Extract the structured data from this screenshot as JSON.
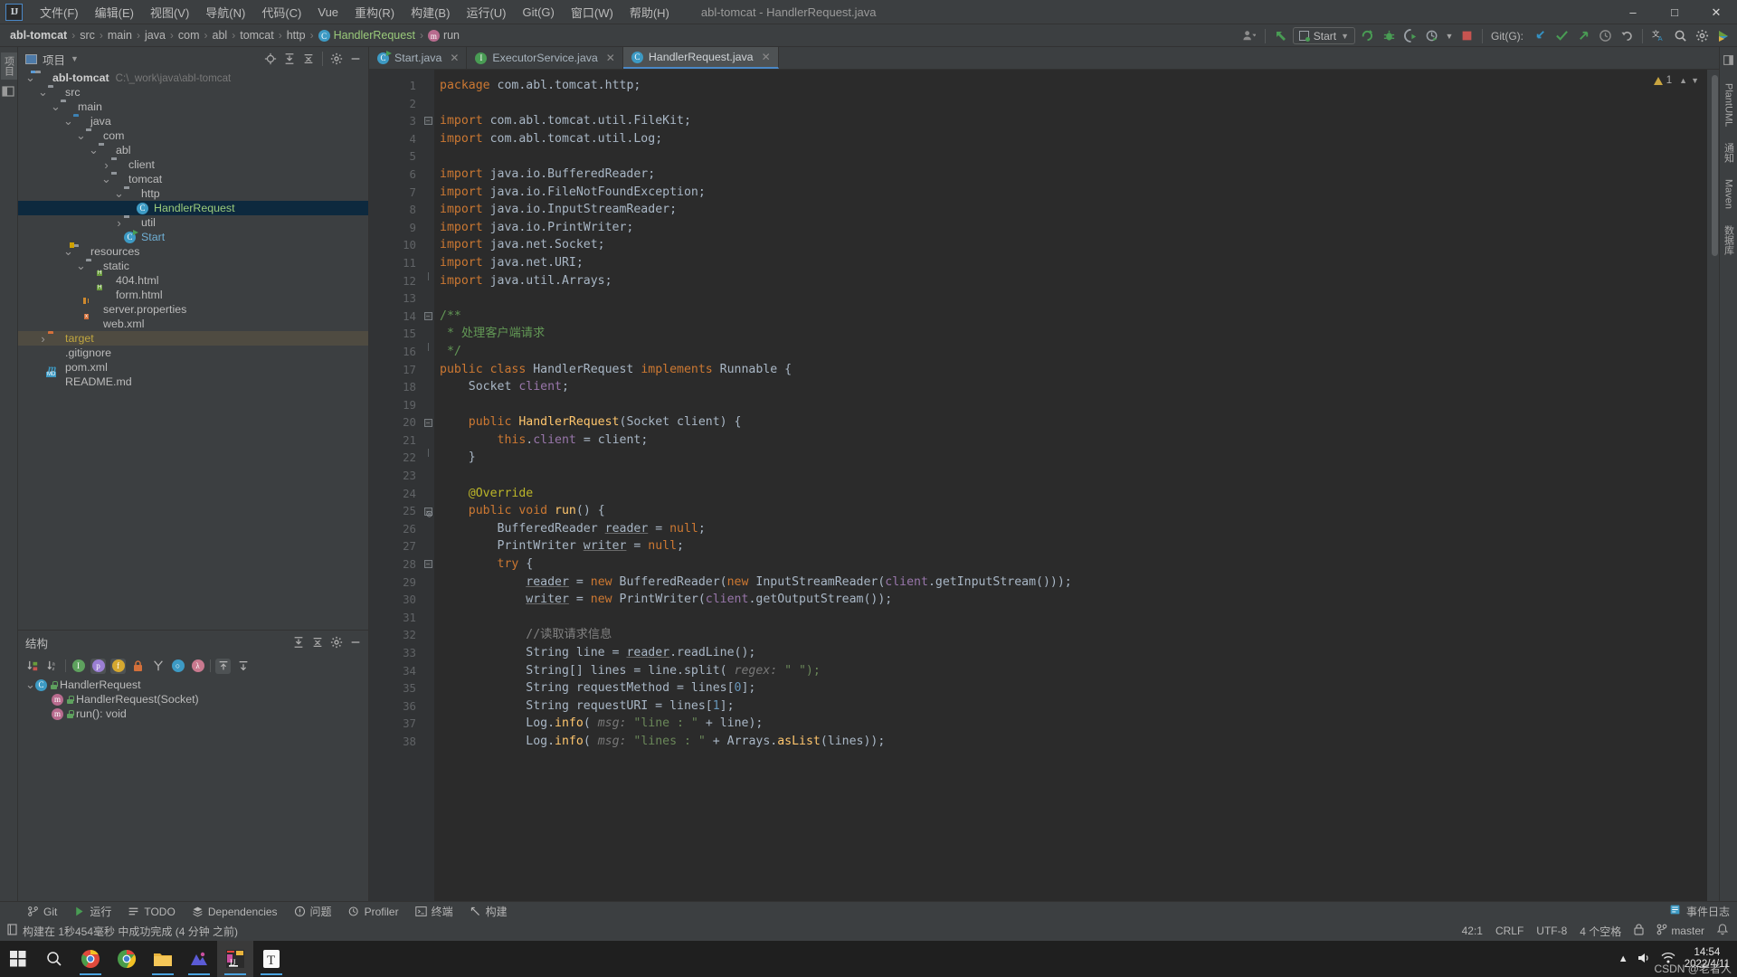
{
  "window": {
    "title": "abl-tomcat - HandlerRequest.java",
    "controls": [
      "minimize",
      "maximize",
      "close"
    ]
  },
  "menubar": {
    "logo": "ij-logo",
    "items": [
      "文件(F)",
      "编辑(E)",
      "视图(V)",
      "导航(N)",
      "代码(C)",
      "Vue",
      "重构(R)",
      "构建(B)",
      "运行(U)",
      "Git(G)",
      "窗口(W)",
      "帮助(H)"
    ]
  },
  "navbar": {
    "breadcrumbs": [
      {
        "label": "abl-tomcat",
        "kind": "project"
      },
      {
        "label": "src",
        "kind": "folder"
      },
      {
        "label": "main",
        "kind": "folder"
      },
      {
        "label": "java",
        "kind": "folder"
      },
      {
        "label": "com",
        "kind": "package"
      },
      {
        "label": "abl",
        "kind": "package"
      },
      {
        "label": "tomcat",
        "kind": "package"
      },
      {
        "label": "http",
        "kind": "package"
      },
      {
        "label": "HandlerRequest",
        "kind": "class"
      },
      {
        "label": "run",
        "kind": "method"
      }
    ],
    "run_config": "Start",
    "git_label": "Git(G):",
    "icons": [
      "user-avatar-icon",
      "back-arrow-icon",
      "run-config-selector",
      "run-icon",
      "debug-icon",
      "run-coverage-icon",
      "profiler-icon",
      "stop-icon",
      "git-update-icon",
      "git-commit-icon",
      "git-push-icon",
      "git-history-icon",
      "git-rollback-icon",
      "translate-icon",
      "search-icon",
      "settings-icon",
      "ide-assistant-icon"
    ]
  },
  "left_rail": {
    "items": [
      "项目",
      "结构"
    ]
  },
  "right_rail": {
    "items": [
      "PlantUML",
      "通知",
      "Maven",
      "数据库",
      "事件日志"
    ]
  },
  "project_panel": {
    "title": "项目",
    "actions": [
      "locate-icon",
      "expand-all-icon",
      "collapse-all-icon",
      "settings-icon",
      "hide-icon"
    ],
    "tree": [
      {
        "depth": 0,
        "label": "abl-tomcat",
        "path": "C:\\_work\\java\\abl-tomcat",
        "icon": "module-folder",
        "arrow": "down",
        "style": "bold"
      },
      {
        "depth": 1,
        "label": "src",
        "icon": "folder",
        "arrow": "down"
      },
      {
        "depth": 2,
        "label": "main",
        "icon": "folder",
        "arrow": "down"
      },
      {
        "depth": 3,
        "label": "java",
        "icon": "source-folder",
        "arrow": "down"
      },
      {
        "depth": 4,
        "label": "com",
        "icon": "package",
        "arrow": "down"
      },
      {
        "depth": 5,
        "label": "abl",
        "icon": "package",
        "arrow": "down"
      },
      {
        "depth": 6,
        "label": "client",
        "icon": "package",
        "arrow": "right"
      },
      {
        "depth": 6,
        "label": "tomcat",
        "icon": "package",
        "arrow": "down"
      },
      {
        "depth": 7,
        "label": "http",
        "icon": "package",
        "arrow": "down"
      },
      {
        "depth": 8,
        "label": "HandlerRequest",
        "icon": "java-class",
        "arrow": "none",
        "selected": true,
        "style": "green"
      },
      {
        "depth": 7,
        "label": "util",
        "icon": "package",
        "arrow": "right"
      },
      {
        "depth": 7,
        "label": "Start",
        "icon": "java-runnable-class",
        "arrow": "none",
        "style": "blue"
      },
      {
        "depth": 3,
        "label": "resources",
        "icon": "resource-folder",
        "arrow": "down"
      },
      {
        "depth": 4,
        "label": "static",
        "icon": "folder",
        "arrow": "down"
      },
      {
        "depth": 5,
        "label": "404.html",
        "icon": "html-file",
        "arrow": "none"
      },
      {
        "depth": 5,
        "label": "form.html",
        "icon": "html-file",
        "arrow": "none"
      },
      {
        "depth": 4,
        "label": "server.properties",
        "icon": "properties-file",
        "arrow": "none"
      },
      {
        "depth": 4,
        "label": "web.xml",
        "icon": "xml-file",
        "arrow": "none"
      },
      {
        "depth": 1,
        "label": "target",
        "icon": "excluded-folder",
        "arrow": "right",
        "highlight": true,
        "style": "orange"
      },
      {
        "depth": 1,
        "label": ".gitignore",
        "icon": "gitignore-file",
        "arrow": "none"
      },
      {
        "depth": 1,
        "label": "pom.xml",
        "icon": "maven-file",
        "arrow": "none"
      },
      {
        "depth": 1,
        "label": "README.md",
        "icon": "markdown-file",
        "arrow": "none"
      }
    ]
  },
  "structure_panel": {
    "title": "结构",
    "actions": [
      "sort-by-visibility-icon",
      "sort-alphabetically-icon",
      "show-inherited-icon",
      "show-properties-icon",
      "show-fields-icon",
      "show-non-public-icon",
      "group-icon",
      "show-interfaces-icon",
      "show-lambdas-icon",
      "expand-all-icon",
      "collapse-all-icon",
      "hide-icon"
    ],
    "tree": [
      {
        "depth": 0,
        "label": "HandlerRequest",
        "icon": "class-icon",
        "arrow": "down",
        "modifier": "public"
      },
      {
        "depth": 1,
        "label": "HandlerRequest(Socket)",
        "icon": "method-icon",
        "arrow": "none",
        "modifier": "public"
      },
      {
        "depth": 1,
        "label": "run(): void",
        "icon": "method-icon",
        "arrow": "none",
        "modifier": "public"
      }
    ]
  },
  "editor": {
    "tabs": [
      {
        "label": "Start.java",
        "icon": "java-runnable-class",
        "active": false
      },
      {
        "label": "ExecutorService.java",
        "icon": "interface",
        "active": false
      },
      {
        "label": "HandlerRequest.java",
        "icon": "java-class",
        "active": true
      }
    ],
    "warning_count": "1",
    "lines": [
      {
        "n": 1,
        "tokens": [
          {
            "t": "package ",
            "c": "kw"
          },
          {
            "t": "com.abl.tomcat.http;",
            "c": "cls2"
          }
        ],
        "indent": 0
      },
      {
        "n": 2,
        "tokens": [],
        "indent": 0
      },
      {
        "n": 3,
        "tokens": [
          {
            "t": "import ",
            "c": "kw"
          },
          {
            "t": "com.abl.tomcat.util.FileKit;",
            "c": "cls2"
          }
        ],
        "indent": 0,
        "fold": "start"
      },
      {
        "n": 4,
        "tokens": [
          {
            "t": "import ",
            "c": "kw"
          },
          {
            "t": "com.abl.tomcat.util.Log;",
            "c": "cls2"
          }
        ],
        "indent": 0
      },
      {
        "n": 5,
        "tokens": [],
        "indent": 0
      },
      {
        "n": 6,
        "tokens": [
          {
            "t": "import ",
            "c": "kw"
          },
          {
            "t": "java.io.BufferedReader;",
            "c": "cls2"
          }
        ],
        "indent": 0
      },
      {
        "n": 7,
        "tokens": [
          {
            "t": "import ",
            "c": "kw"
          },
          {
            "t": "java.io.FileNotFoundException;",
            "c": "cls2"
          }
        ],
        "indent": 0
      },
      {
        "n": 8,
        "tokens": [
          {
            "t": "import ",
            "c": "kw"
          },
          {
            "t": "java.io.InputStreamReader;",
            "c": "cls2"
          }
        ],
        "indent": 0
      },
      {
        "n": 9,
        "tokens": [
          {
            "t": "import ",
            "c": "kw"
          },
          {
            "t": "java.io.PrintWriter;",
            "c": "cls2"
          }
        ],
        "indent": 0
      },
      {
        "n": 10,
        "tokens": [
          {
            "t": "import ",
            "c": "kw"
          },
          {
            "t": "java.net.Socket;",
            "c": "cls2"
          }
        ],
        "indent": 0
      },
      {
        "n": 11,
        "tokens": [
          {
            "t": "import ",
            "c": "kw"
          },
          {
            "t": "java.net.URI;",
            "c": "cls2"
          }
        ],
        "indent": 0
      },
      {
        "n": 12,
        "tokens": [
          {
            "t": "import ",
            "c": "kw"
          },
          {
            "t": "java.util.Arrays;",
            "c": "cls2"
          }
        ],
        "indent": 0,
        "fold": "end"
      },
      {
        "n": 13,
        "tokens": [],
        "indent": 0
      },
      {
        "n": 14,
        "tokens": [
          {
            "t": "/**",
            "c": "jdoc"
          }
        ],
        "indent": 0,
        "fold": "start"
      },
      {
        "n": 15,
        "tokens": [
          {
            "t": " * 处理客户端请求",
            "c": "jdoc"
          }
        ],
        "indent": 0
      },
      {
        "n": 16,
        "tokens": [
          {
            "t": " */",
            "c": "jdoc"
          }
        ],
        "indent": 0,
        "fold": "end"
      },
      {
        "n": 17,
        "tokens": [
          {
            "t": "public class ",
            "c": "kw"
          },
          {
            "t": "HandlerRequest ",
            "c": "cls2"
          },
          {
            "t": "implements ",
            "c": "kw"
          },
          {
            "t": "Runnable {",
            "c": "cls2"
          }
        ],
        "indent": 0
      },
      {
        "n": 18,
        "tokens": [
          {
            "t": "    Socket ",
            "c": "cls2"
          },
          {
            "t": "client",
            "c": "fld"
          },
          {
            "t": ";",
            "c": "cls2"
          }
        ],
        "indent": 0
      },
      {
        "n": 19,
        "tokens": [],
        "indent": 0
      },
      {
        "n": 20,
        "tokens": [
          {
            "t": "    public ",
            "c": "kw"
          },
          {
            "t": "HandlerRequest",
            "c": "mth2"
          },
          {
            "t": "(Socket client) {",
            "c": "cls2"
          }
        ],
        "indent": 0,
        "fold": "start"
      },
      {
        "n": 21,
        "tokens": [
          {
            "t": "        this",
            "c": "kw"
          },
          {
            "t": ".",
            "c": "cls2"
          },
          {
            "t": "client",
            "c": "fld"
          },
          {
            "t": " = client;",
            "c": "cls2"
          }
        ],
        "indent": 0
      },
      {
        "n": 22,
        "tokens": [
          {
            "t": "    }",
            "c": "cls2"
          }
        ],
        "indent": 0,
        "fold": "end"
      },
      {
        "n": 23,
        "tokens": [],
        "indent": 0
      },
      {
        "n": 24,
        "tokens": [
          {
            "t": "    @Override",
            "c": "ann"
          }
        ],
        "indent": 0
      },
      {
        "n": 25,
        "tokens": [
          {
            "t": "    public void ",
            "c": "kw"
          },
          {
            "t": "run",
            "c": "mth2"
          },
          {
            "t": "() {",
            "c": "cls2"
          }
        ],
        "indent": 0,
        "fold": "start",
        "override": true
      },
      {
        "n": 26,
        "tokens": [
          {
            "t": "        BufferedReader ",
            "c": "cls2"
          },
          {
            "t": "reader",
            "c": "uline"
          },
          {
            "t": " = ",
            "c": "cls2"
          },
          {
            "t": "null",
            "c": "kw"
          },
          {
            "t": ";",
            "c": "cls2"
          }
        ],
        "indent": 0
      },
      {
        "n": 27,
        "tokens": [
          {
            "t": "        PrintWriter ",
            "c": "cls2"
          },
          {
            "t": "writer",
            "c": "uline"
          },
          {
            "t": " = ",
            "c": "cls2"
          },
          {
            "t": "null",
            "c": "kw"
          },
          {
            "t": ";",
            "c": "cls2"
          }
        ],
        "indent": 0
      },
      {
        "n": 28,
        "tokens": [
          {
            "t": "        try",
            "c": "kw"
          },
          {
            "t": " {",
            "c": "cls2"
          }
        ],
        "indent": 0,
        "fold": "start"
      },
      {
        "n": 29,
        "tokens": [
          {
            "t": "            ",
            "c": "cls2"
          },
          {
            "t": "reader",
            "c": "uline"
          },
          {
            "t": " = ",
            "c": "cls2"
          },
          {
            "t": "new ",
            "c": "kw"
          },
          {
            "t": "BufferedReader(",
            "c": "cls2"
          },
          {
            "t": "new ",
            "c": "kw"
          },
          {
            "t": "InputStreamReader(",
            "c": "cls2"
          },
          {
            "t": "client",
            "c": "fld"
          },
          {
            "t": ".getInputStream()));",
            "c": "cls2"
          }
        ],
        "indent": 0
      },
      {
        "n": 30,
        "tokens": [
          {
            "t": "            ",
            "c": "cls2"
          },
          {
            "t": "writer",
            "c": "uline"
          },
          {
            "t": " = ",
            "c": "cls2"
          },
          {
            "t": "new ",
            "c": "kw"
          },
          {
            "t": "PrintWriter(",
            "c": "cls2"
          },
          {
            "t": "client",
            "c": "fld"
          },
          {
            "t": ".getOutputStream());",
            "c": "cls2"
          }
        ],
        "indent": 0
      },
      {
        "n": 31,
        "tokens": [],
        "indent": 0
      },
      {
        "n": 32,
        "tokens": [
          {
            "t": "            //读取请求信息",
            "c": "cmt"
          }
        ],
        "indent": 0
      },
      {
        "n": 33,
        "tokens": [
          {
            "t": "            String line = ",
            "c": "cls2"
          },
          {
            "t": "reader",
            "c": "uline"
          },
          {
            "t": ".readLine();",
            "c": "cls2"
          }
        ],
        "indent": 0
      },
      {
        "n": 34,
        "tokens": [
          {
            "t": "            String[] lines = line.split( ",
            "c": "cls2"
          },
          {
            "t": "regex:",
            "c": "hint"
          },
          {
            "t": " \" \");",
            "c": "str"
          }
        ],
        "indent": 0
      },
      {
        "n": 35,
        "tokens": [
          {
            "t": "            String requestMethod = lines[",
            "c": "cls2"
          },
          {
            "t": "0",
            "c": "num"
          },
          {
            "t": "];",
            "c": "cls2"
          }
        ],
        "indent": 0
      },
      {
        "n": 36,
        "tokens": [
          {
            "t": "            String requestURI = lines[",
            "c": "cls2"
          },
          {
            "t": "1",
            "c": "num"
          },
          {
            "t": "];",
            "c": "cls2"
          }
        ],
        "indent": 0
      },
      {
        "n": 37,
        "tokens": [
          {
            "t": "            Log.",
            "c": "cls2"
          },
          {
            "t": "info",
            "c": "mth2"
          },
          {
            "t": "( ",
            "c": "cls2"
          },
          {
            "t": "msg:",
            "c": "hint"
          },
          {
            "t": " \"line : \"",
            "c": "str"
          },
          {
            "t": " + line);",
            "c": "cls2"
          }
        ],
        "indent": 0
      },
      {
        "n": 38,
        "tokens": [
          {
            "t": "            Log.",
            "c": "cls2"
          },
          {
            "t": "info",
            "c": "mth2"
          },
          {
            "t": "( ",
            "c": "cls2"
          },
          {
            "t": "msg:",
            "c": "hint"
          },
          {
            "t": " \"lines : \"",
            "c": "str"
          },
          {
            "t": " + Arrays.",
            "c": "cls2"
          },
          {
            "t": "asList",
            "c": "mth2"
          },
          {
            "t": "(lines));",
            "c": "cls2"
          }
        ],
        "indent": 0
      }
    ]
  },
  "bottom_toolbar": {
    "items": [
      {
        "label": "Git",
        "icon": "git-icon"
      },
      {
        "label": "运行",
        "icon": "run-icon"
      },
      {
        "label": "TODO",
        "icon": "todo-icon"
      },
      {
        "label": "Dependencies",
        "icon": "dependencies-icon"
      },
      {
        "label": "问题",
        "icon": "problems-icon"
      },
      {
        "label": "Profiler",
        "icon": "profiler-icon"
      },
      {
        "label": "终端",
        "icon": "terminal-icon"
      },
      {
        "label": "构建",
        "icon": "build-icon"
      }
    ],
    "right_label": "事件日志",
    "right_icon": "event-log-icon"
  },
  "statusbar": {
    "message": "构建在 1秒454毫秒 中成功完成 (4 分钟 之前)",
    "message_icon": "build-status-icon",
    "caret": "42:1",
    "line_sep": "CRLF",
    "encoding": "UTF-8",
    "indent": "4 个空格",
    "branch": "master",
    "branch_icon": "git-branch-icon",
    "lock_icon": "lock-icon"
  },
  "taskbar": {
    "items": [
      "start-icon",
      "search-icon",
      "chrome-canary-icon",
      "chrome-icon",
      "file-explorer-icon",
      "wps-icon",
      "intellij-idea-icon",
      "typora-icon"
    ],
    "clock_time": "14:54",
    "clock_date": "2022/4/11",
    "tray": [
      "chevron-up-icon",
      "network-icon",
      "volume-icon"
    ],
    "watermark": "CSDN @老者人"
  },
  "colors": {
    "bg_panel": "#3c3f41",
    "bg_editor": "#2b2b2b",
    "bg_gutter": "#313335",
    "selection": "#0d293e",
    "accent_blue": "#4a88c7",
    "green": "#499c54",
    "keyword": "#cc7832",
    "string": "#6a8759",
    "number": "#6897bb",
    "comment": "#808080",
    "field": "#9876aa",
    "method": "#ffc66d",
    "annotation": "#bbb529"
  }
}
